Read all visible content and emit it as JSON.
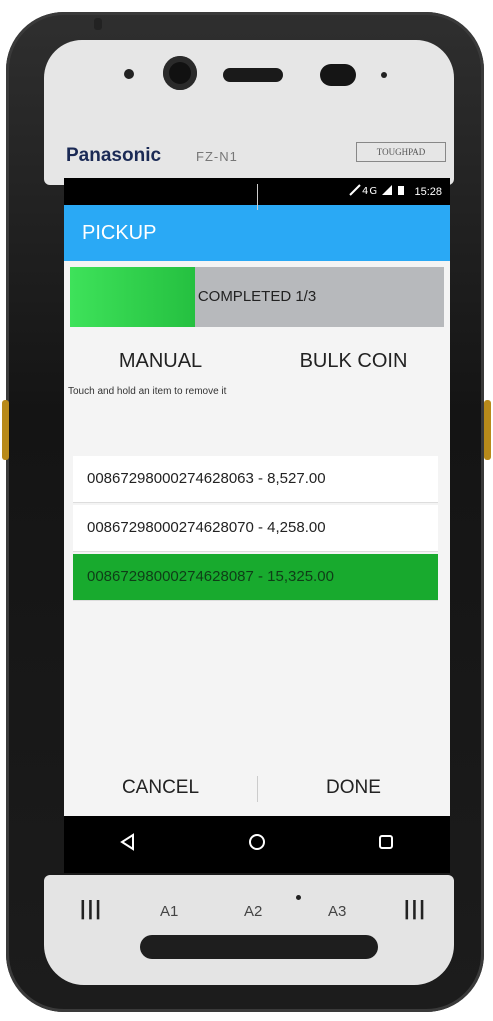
{
  "device": {
    "brand": "Panasonic",
    "model": "FZ-N1",
    "badge": "TOUGHPAD",
    "keys": [
      "A1",
      "A2",
      "A3"
    ]
  },
  "statusbar": {
    "time": "15:28",
    "icons": "signal-wifi-battery"
  },
  "appbar": {
    "title": "PICKUP"
  },
  "progress": {
    "label": "COMPLETED 1/3",
    "fraction": 0.333,
    "colors": {
      "fill": "#3ee25a",
      "track": "#b7b9bc"
    }
  },
  "tabs": [
    {
      "label": "MANUAL"
    },
    {
      "label": "BULK COIN"
    }
  ],
  "hint": "Touch and hold an item to remove it",
  "items": [
    {
      "label": "00867298000274628063 - 8,527.00",
      "selected": false
    },
    {
      "label": "00867298000274628070 - 4,258.00",
      "selected": false
    },
    {
      "label": "00867298000274628087 - 15,325.00",
      "selected": true
    }
  ],
  "actions": {
    "cancel": "CANCEL",
    "done": "DONE"
  },
  "navbar": [
    "back-icon",
    "home-icon",
    "recents-icon"
  ],
  "colors": {
    "appbar": "#2aa9f5",
    "selected_row": "#18aa2e"
  }
}
